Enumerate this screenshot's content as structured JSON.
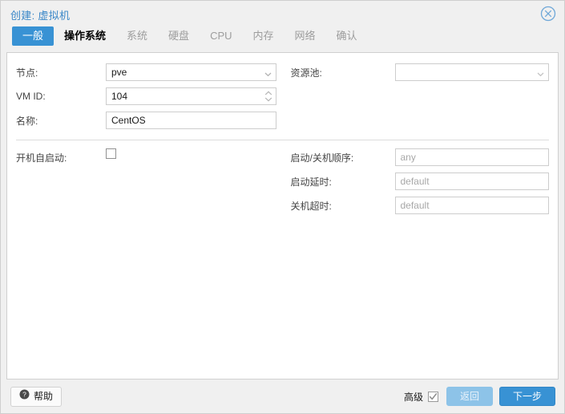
{
  "dialog": {
    "title": "创建: 虚拟机",
    "close_icon": "close-circle-icon"
  },
  "tabs": [
    {
      "label": "一般",
      "state": "active"
    },
    {
      "label": "操作系统",
      "state": "enabled"
    },
    {
      "label": "系统",
      "state": "disabled"
    },
    {
      "label": "硬盘",
      "state": "disabled"
    },
    {
      "label": "CPU",
      "state": "disabled"
    },
    {
      "label": "内存",
      "state": "disabled"
    },
    {
      "label": "网络",
      "state": "disabled"
    },
    {
      "label": "确认",
      "state": "disabled"
    }
  ],
  "form": {
    "left": {
      "node": {
        "label": "节点:",
        "value": "pve",
        "icon": "chevron-down-icon"
      },
      "vmid": {
        "label": "VM ID:",
        "value": "104",
        "icon": "spinner-arrows-icon"
      },
      "name": {
        "label": "名称:",
        "value": "CentOS"
      },
      "start_at_boot": {
        "label": "开机自启动:",
        "checked": false
      }
    },
    "right": {
      "pool": {
        "label": "资源池:",
        "value": "",
        "icon": "chevron-down-icon"
      },
      "start_order": {
        "label": "启动/关机顺序:",
        "value": "",
        "placeholder": "any"
      },
      "startup_delay": {
        "label": "启动延时:",
        "value": "",
        "placeholder": "default"
      },
      "shutdown_timeout": {
        "label": "关机超时:",
        "value": "",
        "placeholder": "default"
      }
    }
  },
  "footer": {
    "help_label": "帮助",
    "help_icon": "question-circle-icon",
    "advanced_label": "高级",
    "advanced_checked": true,
    "back_label": "返回",
    "next_label": "下一步"
  },
  "colors": {
    "accent": "#3892d4",
    "title": "#3a87c8",
    "disabled_tab": "#9d9d9d",
    "placeholder": "#a8a8a8",
    "chrome": "#f0f0f0"
  }
}
